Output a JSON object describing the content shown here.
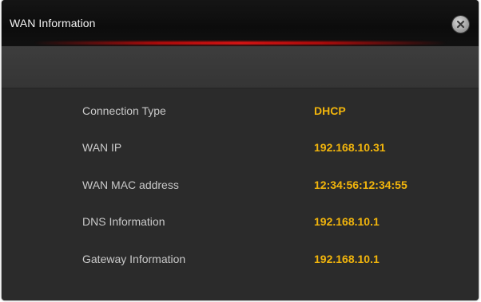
{
  "dialog": {
    "title": "WAN Information"
  },
  "rows": [
    {
      "label": "Connection Type",
      "value": "DHCP"
    },
    {
      "label": "WAN IP",
      "value": "192.168.10.31"
    },
    {
      "label": "WAN MAC address",
      "value": "12:34:56:12:34:55"
    },
    {
      "label": "DNS Information",
      "value": "192.168.10.1"
    },
    {
      "label": "Gateway Information",
      "value": "192.168.10.1"
    }
  ],
  "colors": {
    "value_text": "#f2b50c",
    "accent_line": "#eb1414",
    "background": "#2b2b2b"
  },
  "icons": {
    "close": "close-icon"
  }
}
